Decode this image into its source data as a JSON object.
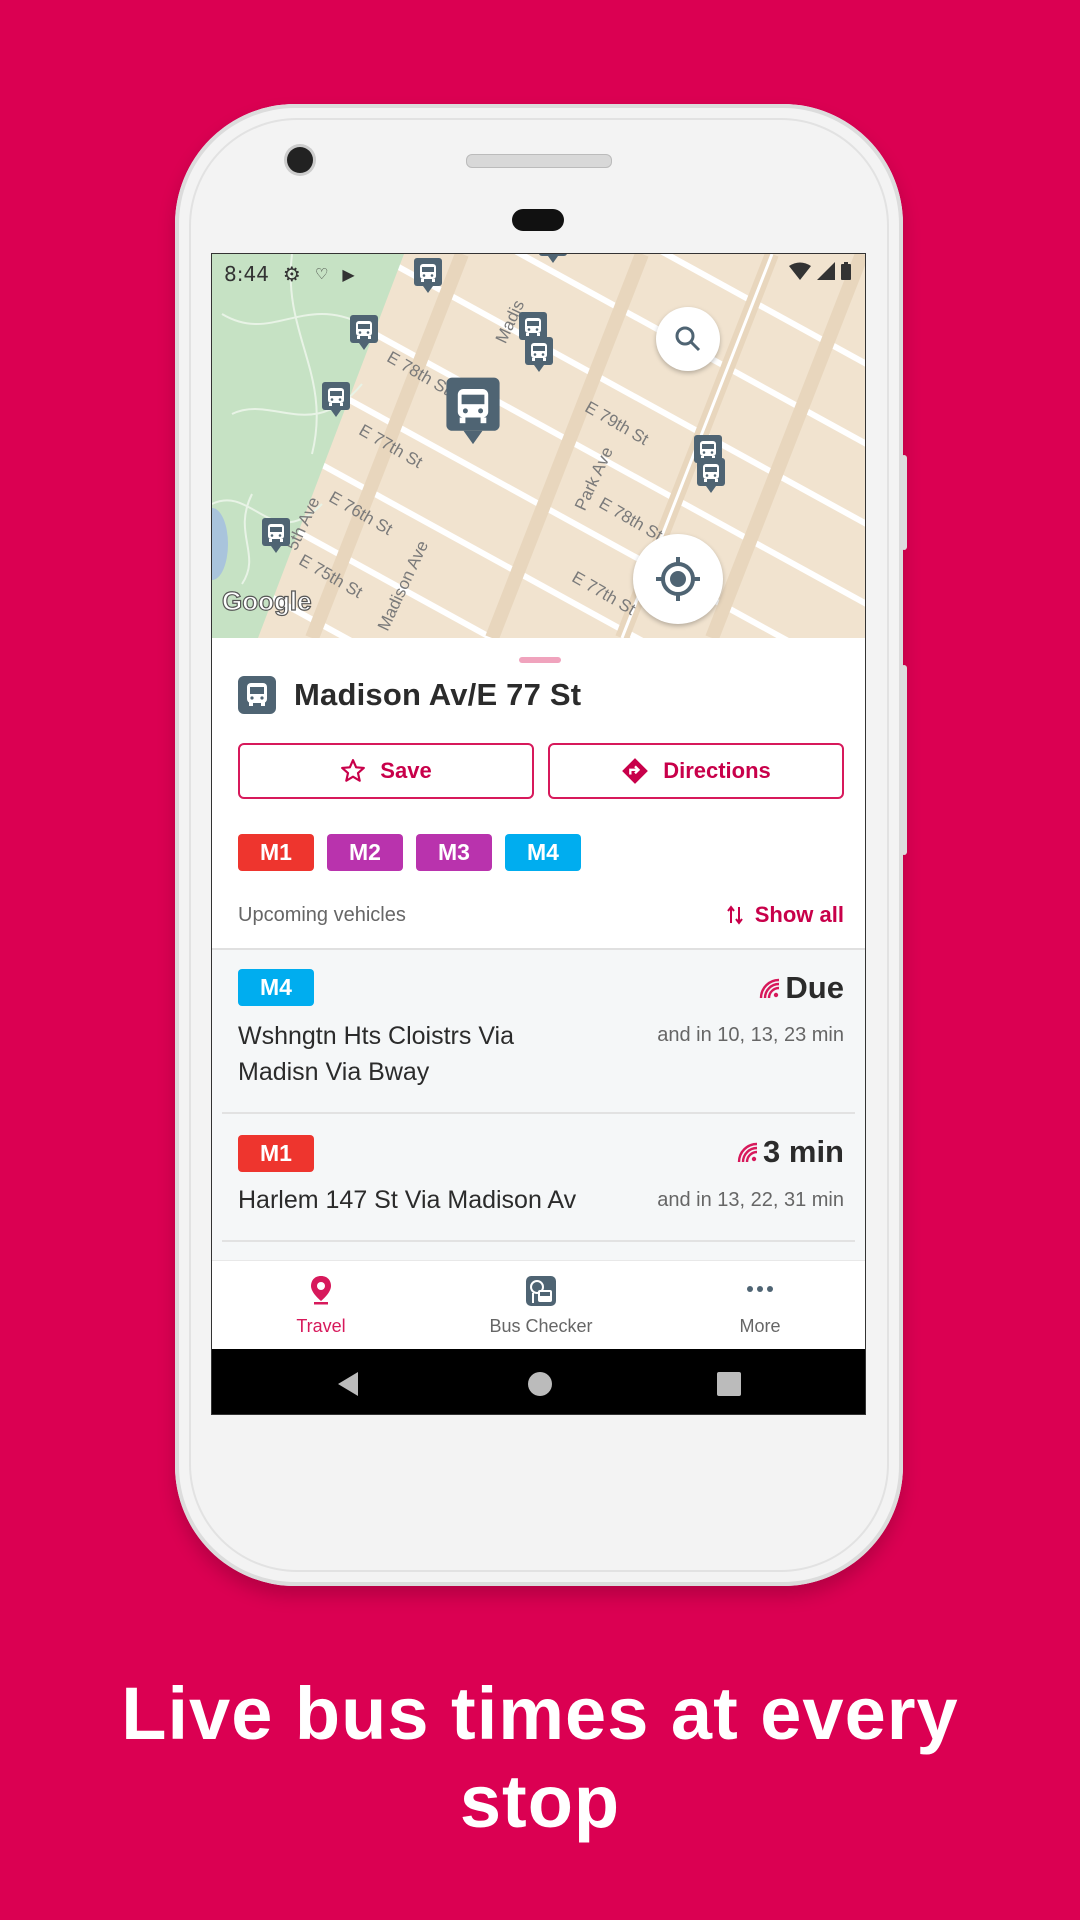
{
  "status_bar": {
    "time": "8:44"
  },
  "map": {
    "attribution": "Google",
    "street_labels": [
      "E 78th St",
      "E 77th St",
      "E 76th St",
      "E 75th St",
      "E 79th St",
      "E 78th St",
      "E 77th St",
      "Madis",
      "Madison Ave",
      "Park Ave",
      "5th Ave"
    ],
    "colors": {
      "land": "#F1E3CF",
      "park": "#C6E2C4",
      "marker": "#4F6473"
    }
  },
  "stop": {
    "name": "Madison Av/E 77 St",
    "save_label": "Save",
    "directions_label": "Directions",
    "routes": [
      {
        "label": "M1",
        "color": "#EE352E"
      },
      {
        "label": "M2",
        "color": "#B933AD"
      },
      {
        "label": "M3",
        "color": "#B933AD"
      },
      {
        "label": "M4",
        "color": "#00ADEF"
      }
    ],
    "upcoming_label": "Upcoming vehicles",
    "show_all_label": "Show all"
  },
  "departures": [
    {
      "route": "M4",
      "color": "#00ADEF",
      "destination_line1": "Wshngtn Hts Cloistrs Via",
      "destination_line2": "Madisn Via Bway",
      "eta": "Due",
      "more": "and in 10, 13, 23 min"
    },
    {
      "route": "M1",
      "color": "#EE352E",
      "destination_line1": "Harlem 147 St Via Madison Av",
      "destination_line2": "",
      "eta": "3 min",
      "more": "and in 13, 22, 31 min"
    }
  ],
  "bottom_nav": [
    {
      "label": "Travel",
      "icon": "location-pin-icon",
      "active": true
    },
    {
      "label": "Bus Checker",
      "icon": "bus-stop-icon",
      "active": false
    },
    {
      "label": "More",
      "icon": "more-dots-icon",
      "active": false
    }
  ],
  "caption": {
    "line1": "Live bus times at every",
    "line2": "stop"
  },
  "colors": {
    "background": "#DB0052",
    "accent": "#C8004A"
  }
}
